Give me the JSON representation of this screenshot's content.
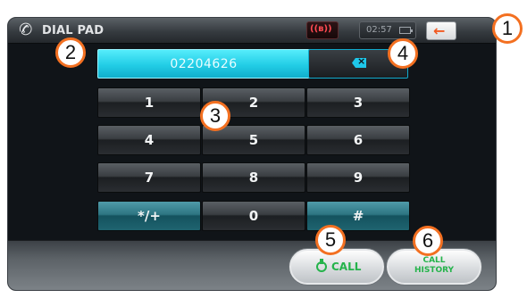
{
  "titlebar": {
    "title": "DIAL PAD",
    "bluetooth_label": "((ʙ))",
    "clock": "02:57",
    "icons": {
      "app": "phone-icon",
      "bluetooth": "bluetooth-icon",
      "battery": "battery-icon",
      "back": "back-arrow-icon"
    }
  },
  "dialpad": {
    "number": "02204626",
    "keys": [
      "1",
      "2",
      "3",
      "4",
      "5",
      "6",
      "7",
      "8",
      "9",
      "*/+",
      "0",
      "#"
    ]
  },
  "actions": {
    "call_label": "CALL",
    "history_label_line1": "CALL",
    "history_label_line2": "HISTORY"
  },
  "callouts": [
    "1",
    "2",
    "3",
    "4",
    "5",
    "6"
  ],
  "colors": {
    "accent_cyan": "#22cde6",
    "teal_key": "#2d7582",
    "call_green": "#25b34b",
    "callout_orange": "#f37021",
    "back_arrow": "#f15a22"
  }
}
